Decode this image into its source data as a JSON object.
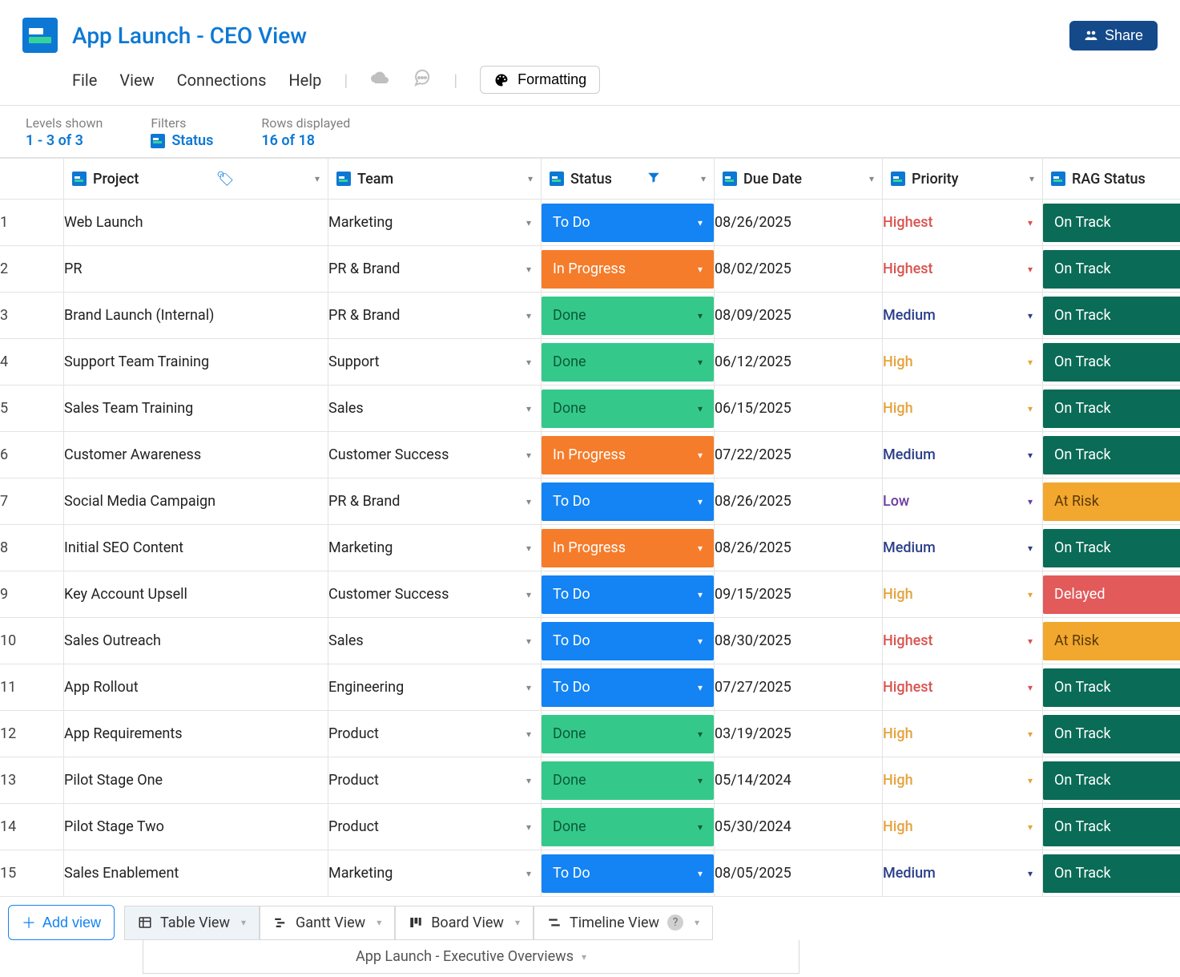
{
  "header": {
    "title": "App Launch - CEO View",
    "share_label": "Share"
  },
  "menu": {
    "file": "File",
    "view": "View",
    "connections": "Connections",
    "help": "Help",
    "formatting": "Formatting"
  },
  "info": {
    "levels_label": "Levels shown",
    "levels_value": "1 - 3 of 3",
    "filters_label": "Filters",
    "filters_value": "Status",
    "rows_label": "Rows displayed",
    "rows_value": "16 of 18"
  },
  "columns": {
    "project": "Project",
    "team": "Team",
    "status": "Status",
    "due": "Due Date",
    "priority": "Priority",
    "rag": "RAG Status"
  },
  "status_labels": {
    "todo": "To Do",
    "inprogress": "In Progress",
    "done": "Done"
  },
  "rag_labels": {
    "ontrack": "On Track",
    "atrisk": "At Risk",
    "delayed": "Delayed"
  },
  "priority_labels": {
    "highest": "Highest",
    "high": "High",
    "medium": "Medium",
    "low": "Low"
  },
  "rows": [
    {
      "n": "1",
      "project": "Web Launch",
      "team": "Marketing",
      "status": "todo",
      "due": "08/26/2025",
      "priority": "highest",
      "rag": "ontrack"
    },
    {
      "n": "2",
      "project": "PR",
      "team": "PR & Brand",
      "status": "inprogress",
      "due": "08/02/2025",
      "priority": "highest",
      "rag": "ontrack"
    },
    {
      "n": "3",
      "project": "Brand Launch (Internal)",
      "team": "PR & Brand",
      "status": "done",
      "due": "08/09/2025",
      "priority": "medium",
      "rag": "ontrack"
    },
    {
      "n": "4",
      "project": "Support Team Training",
      "team": "Support",
      "status": "done",
      "due": "06/12/2025",
      "priority": "high",
      "rag": "ontrack"
    },
    {
      "n": "5",
      "project": "Sales Team Training",
      "team": "Sales",
      "status": "done",
      "due": "06/15/2025",
      "priority": "high",
      "rag": "ontrack"
    },
    {
      "n": "6",
      "project": "Customer Awareness",
      "team": "Customer Success",
      "status": "inprogress",
      "due": "07/22/2025",
      "priority": "medium",
      "rag": "ontrack"
    },
    {
      "n": "7",
      "project": "Social Media Campaign",
      "team": "PR & Brand",
      "status": "todo",
      "due": "08/26/2025",
      "priority": "low",
      "rag": "atrisk"
    },
    {
      "n": "8",
      "project": "Initial SEO Content",
      "team": "Marketing",
      "status": "inprogress",
      "due": "08/26/2025",
      "priority": "medium",
      "rag": "ontrack"
    },
    {
      "n": "9",
      "project": "Key Account Upsell",
      "team": "Customer Success",
      "status": "todo",
      "due": "09/15/2025",
      "priority": "high",
      "rag": "delayed"
    },
    {
      "n": "10",
      "project": "Sales Outreach",
      "team": "Sales",
      "status": "todo",
      "due": "08/30/2025",
      "priority": "highest",
      "rag": "atrisk"
    },
    {
      "n": "11",
      "project": "App Rollout",
      "team": "Engineering",
      "status": "todo",
      "due": "07/27/2025",
      "priority": "highest",
      "rag": "ontrack"
    },
    {
      "n": "12",
      "project": "App Requirements",
      "team": "Product",
      "status": "done",
      "due": "03/19/2025",
      "priority": "high",
      "rag": "ontrack"
    },
    {
      "n": "13",
      "project": "Pilot Stage One",
      "team": "Product",
      "status": "done",
      "due": "05/14/2024",
      "priority": "high",
      "rag": "ontrack"
    },
    {
      "n": "14",
      "project": "Pilot Stage Two",
      "team": "Product",
      "status": "done",
      "due": "05/30/2024",
      "priority": "high",
      "rag": "ontrack"
    },
    {
      "n": "15",
      "project": "Sales Enablement",
      "team": "Marketing",
      "status": "todo",
      "due": "08/05/2025",
      "priority": "medium",
      "rag": "ontrack"
    }
  ],
  "bottom": {
    "add_view": "Add view",
    "tabs": [
      "Table View",
      "Gantt View",
      "Board View",
      "Timeline View"
    ],
    "sheet": "App Launch - Executive Overviews"
  }
}
